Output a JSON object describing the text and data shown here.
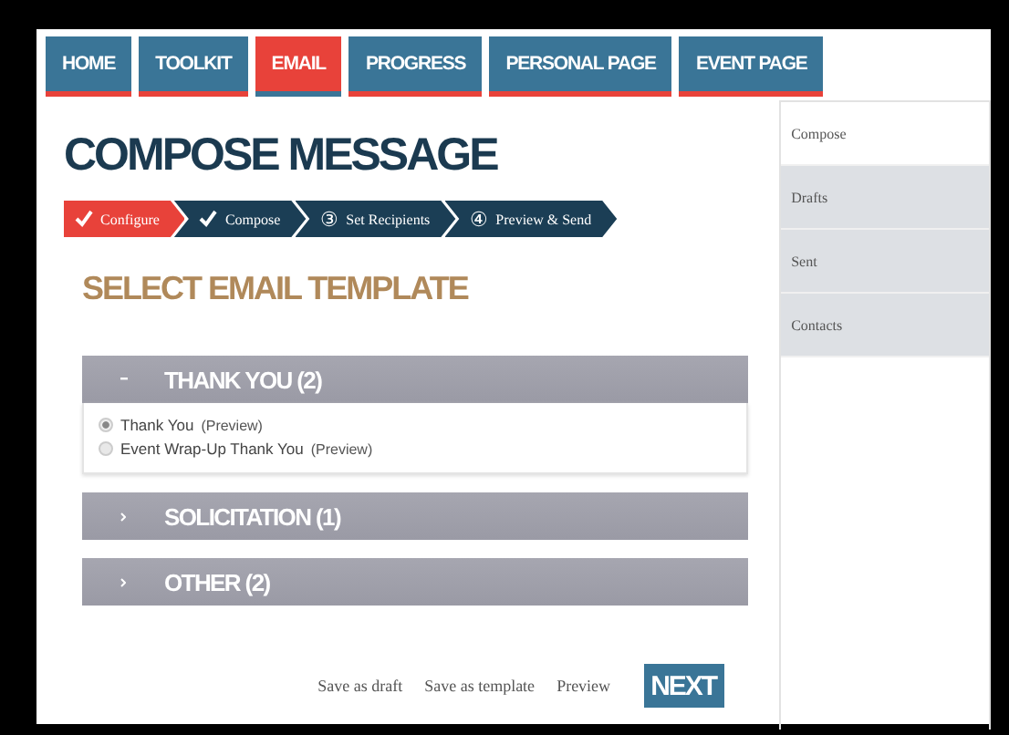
{
  "nav": [
    {
      "label": "HOME",
      "selected": false
    },
    {
      "label": "TOOLKIT",
      "selected": false
    },
    {
      "label": "EMAIL",
      "selected": true
    },
    {
      "label": "PROGRESS",
      "selected": false
    },
    {
      "label": "PERSONAL PAGE",
      "selected": false
    },
    {
      "label": "EVENT PAGE",
      "selected": false
    }
  ],
  "title": "COMPOSE MESSAGE",
  "steps": [
    {
      "label": "Configure",
      "done": true,
      "selected": true
    },
    {
      "label": "Compose",
      "done": true,
      "selected": false
    },
    {
      "number": "③",
      "label": "Set Recipients",
      "done": false,
      "selected": false
    },
    {
      "number": "④",
      "label": "Preview & Send",
      "done": false,
      "selected": false
    }
  ],
  "subtitle": "SELECT EMAIL TEMPLATE",
  "sections": [
    {
      "title": "THANK YOU (2)",
      "expanded": true,
      "items": [
        {
          "label": "Thank You",
          "link": "(Preview)",
          "selected": true
        },
        {
          "label": "Event Wrap-Up Thank You",
          "link": "(Preview)",
          "selected": false
        }
      ]
    },
    {
      "title": "SOLICITATION (1)",
      "expanded": false
    },
    {
      "title": "OTHER (2)",
      "expanded": false
    }
  ],
  "footer": {
    "links": [
      "Save as draft",
      "Save as template",
      "Preview"
    ],
    "next": "NEXT"
  },
  "sidebar": [
    {
      "label": "Compose",
      "selected": true
    },
    {
      "label": "Drafts",
      "selected": false
    },
    {
      "label": "Sent",
      "selected": false
    },
    {
      "label": "Contacts",
      "selected": false
    }
  ]
}
